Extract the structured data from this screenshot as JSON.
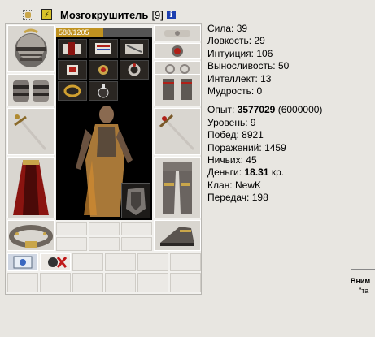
{
  "header": {
    "nick": "Мозгокрушитель",
    "level": "[9]",
    "info_label": "i"
  },
  "equipment": {
    "hp_text": "588/1205",
    "hp_fraction": 0.488,
    "slots": [
      "helmet-icon",
      "bracers-icon",
      "sword-icon",
      "cloak-icon",
      "belt-icon",
      "ring-icon",
      "amulet-icon",
      "gloves-icon",
      "weapon-icon",
      "armor-icon",
      "boots-icon"
    ]
  },
  "stats": {
    "str_label": "Сила:",
    "str": "39",
    "agi_label": "Ловкость:",
    "agi": "29",
    "int_label": "Интуиция:",
    "int": "106",
    "end_label": "Выносливость:",
    "end": "50",
    "intel_label": "Интеллект:",
    "intel": "13",
    "wis_label": "Мудрость:",
    "wis": "0",
    "exp_label": "Опыт:",
    "exp": "3577029",
    "exp_next": "(6000000)",
    "level_label": "Уровень:",
    "level": "9",
    "wins_label": "Побед:",
    "wins": "8921",
    "losses_label": "Поражений:",
    "losses": "1459",
    "draws_label": "Ничьих:",
    "draws": "45",
    "money_label": "Деньги:",
    "money": "18.31",
    "money_unit": "кр.",
    "clan_label": "Клан:",
    "clan": "NewK",
    "transfers_label": "Передач:",
    "transfers": "198"
  },
  "notice": {
    "title": "Вним",
    "text": "\"та"
  },
  "colors": {
    "background": "#e8e6e1",
    "hp_fill": "#c09220",
    "clan_badge": "#d8c22a",
    "info_badge": "#1c3fb0"
  }
}
